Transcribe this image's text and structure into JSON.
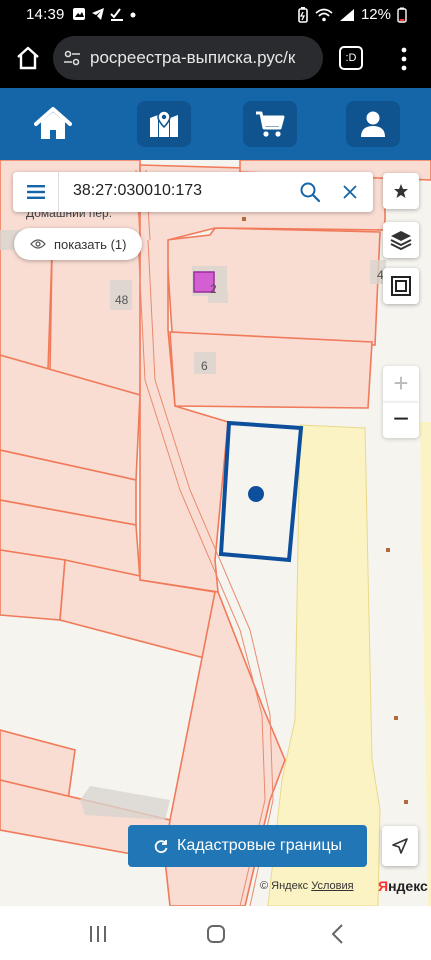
{
  "status": {
    "time": "14:39",
    "battery": "12%"
  },
  "browser": {
    "url": "росреестра-выписка.рус/к",
    "tab_icon": ":D"
  },
  "nav": {
    "items": [
      "home-icon",
      "map-pin-icon",
      "cart-icon",
      "user-icon"
    ]
  },
  "search": {
    "value": "38:27:030010:173"
  },
  "map": {
    "street": "Домашний пер.",
    "show_button": "показать (1)",
    "building_numbers": [
      "48",
      "2",
      "6",
      "4"
    ],
    "cadastral_button": "Кадастровые границы",
    "copyright": "© Яндекс",
    "terms": "Условия",
    "logo_y": "Я",
    "logo_rest": "ндекс"
  },
  "colors": {
    "nav_bg": "#1565a9",
    "parcel_fill": "#f9ddd3",
    "parcel_stroke": "#f07a5a",
    "selected_stroke": "#0d4f9c",
    "field_fill": "#fbf3c4"
  }
}
